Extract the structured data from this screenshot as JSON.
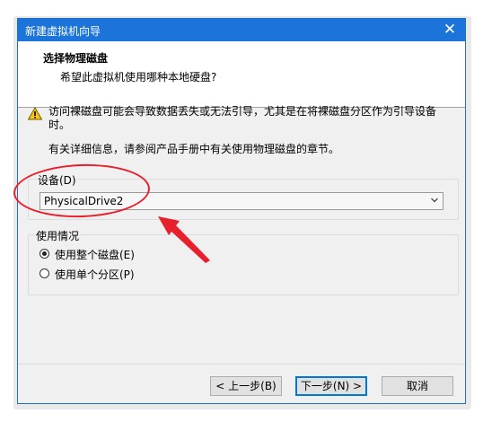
{
  "window": {
    "title": "新建虚拟机向导"
  },
  "header": {
    "title": "选择物理磁盘",
    "subtitle": "希望此虚拟机使用哪种本地硬盘?"
  },
  "warning": {
    "text": "访问裸磁盘可能会导致数据丢失或无法引导，尤其是在将裸磁盘分区作为引导设备时。"
  },
  "info": {
    "text": "有关详细信息，请参阅产品手册中有关使用物理磁盘的章节。"
  },
  "device": {
    "label": "设备(D)",
    "selected": "PhysicalDrive2"
  },
  "usage": {
    "label": "使用情况",
    "options": [
      {
        "label": "使用整个磁盘(E)",
        "selected": true
      },
      {
        "label": "使用单个分区(P)",
        "selected": false
      }
    ]
  },
  "buttons": {
    "back": "< 上一步(B)",
    "next": "下一步(N) >",
    "cancel": "取消"
  },
  "colors": {
    "titlebar": "#1c73d9",
    "annotation": "#e8202c",
    "default_button_border": "#0078d7"
  }
}
